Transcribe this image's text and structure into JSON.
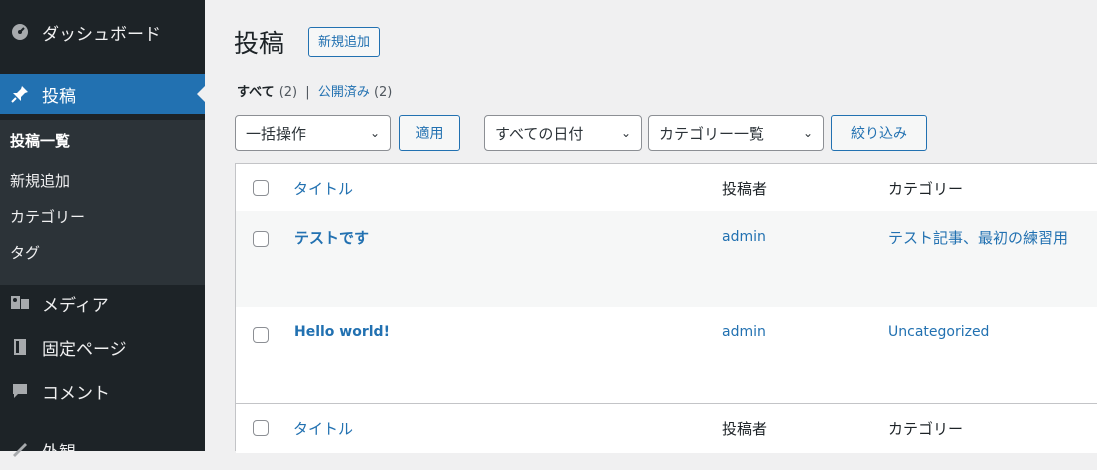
{
  "sidebar": {
    "items": [
      {
        "label": "ダッシュボード",
        "icon": "dashboard-icon"
      },
      {
        "label": "投稿",
        "icon": "pin-icon",
        "active": true
      },
      {
        "label": "メディア",
        "icon": "media-icon"
      },
      {
        "label": "固定ページ",
        "icon": "page-icon"
      },
      {
        "label": "コメント",
        "icon": "comment-icon"
      },
      {
        "label": "外観",
        "icon": "appearance-icon"
      }
    ],
    "submenu": [
      "投稿一覧",
      "新規追加",
      "カテゴリー",
      "タグ"
    ]
  },
  "header": {
    "title": "投稿",
    "add_new": "新規追加"
  },
  "views": {
    "all_label": "すべて",
    "all_count": "(2)",
    "separator": "|",
    "published_label": "公開済み",
    "published_count": "(2)"
  },
  "filters": {
    "bulk_action": "一括操作",
    "apply": "適用",
    "dates": "すべての日付",
    "categories": "カテゴリー一覧",
    "filter": "絞り込み"
  },
  "table": {
    "headers": {
      "title": "タイトル",
      "author": "投稿者",
      "categories": "カテゴリー"
    },
    "rows": [
      {
        "title": "テストです",
        "author": "admin",
        "categories": "テスト記事、最初の練習用"
      },
      {
        "title": "Hello world!",
        "author": "admin",
        "categories": "Uncategorized"
      }
    ]
  },
  "colors": {
    "accent": "#2271b1",
    "sidebar": "#1d2327",
    "background": "#f0f0f1"
  }
}
